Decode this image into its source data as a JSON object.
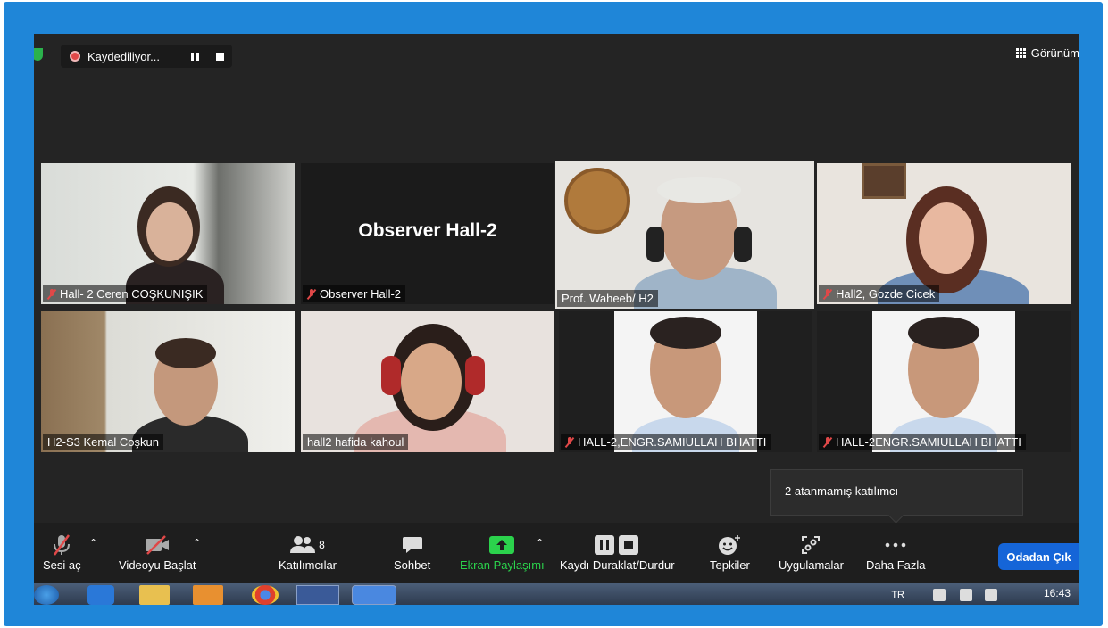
{
  "recording": {
    "label": "Kaydediliyor..."
  },
  "view": {
    "label": "Görünüm"
  },
  "tiles": [
    {
      "name": "Hall- 2 Ceren COŞKUNIŞIK",
      "muted": true
    },
    {
      "name": "Observer Hall-2",
      "muted": true,
      "big_label": "Observer Hall-2"
    },
    {
      "name": "Prof. Waheeb/ H2",
      "muted": false,
      "active": true
    },
    {
      "name": "Hall2, Gozde Cicek",
      "muted": true
    },
    {
      "name": "H2-S3 Kemal Coşkun",
      "muted": false
    },
    {
      "name": "hall2 hafida kahoul",
      "muted": false
    },
    {
      "name": "HALL-2,ENGR.SAMIULLAH BHATTI",
      "muted": true
    },
    {
      "name": "HALL-2ENGR.SAMIULLAH BHATTI",
      "muted": true
    }
  ],
  "unassigned_tooltip": "2 atanmamış katılımcı",
  "toolbar": {
    "audio": "Sesi aç",
    "video": "Videoyu Başlat",
    "participants": "Katılımcılar",
    "participants_count": "8",
    "chat": "Sohbet",
    "share": "Ekran Paylaşımı",
    "record": "Kaydı Duraklat/Durdur",
    "reactions": "Tepkiler",
    "apps": "Uygulamalar",
    "more": "Daha Fazla",
    "leave": "Odadan Çık"
  },
  "taskbar": {
    "lang": "TR",
    "time": "16:43"
  },
  "colors": {
    "accent_green": "#2bd24c",
    "active_border": "#c9e65a",
    "leave_blue": "#1565d8",
    "muted_red": "#e04848"
  }
}
